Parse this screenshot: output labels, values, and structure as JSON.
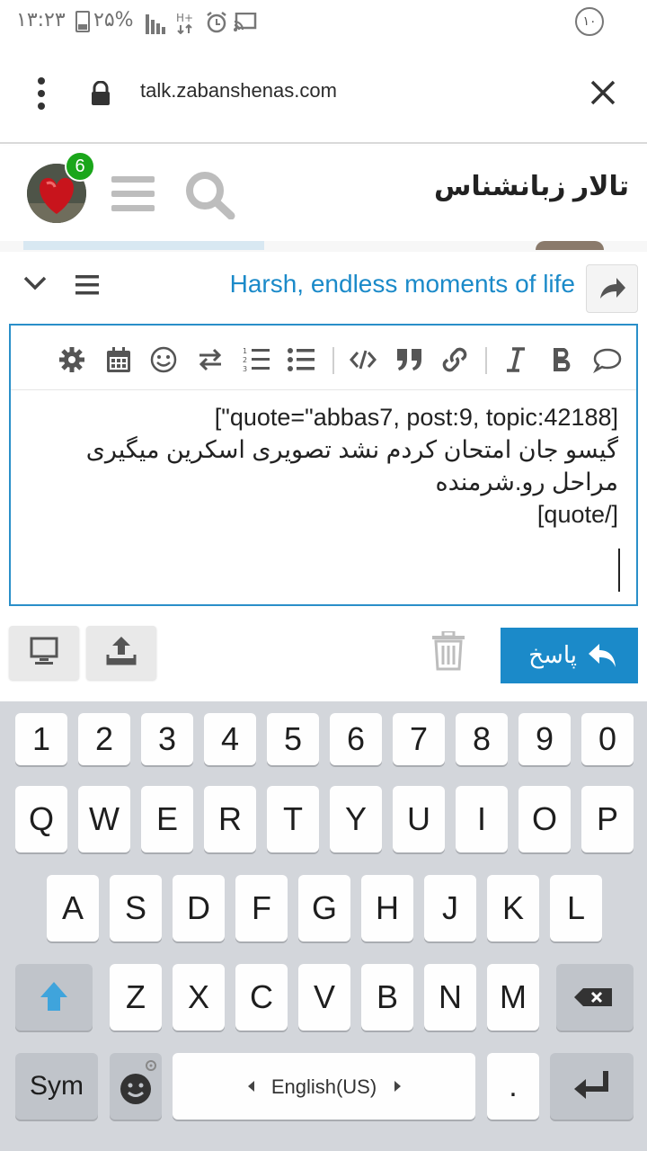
{
  "status_bar": {
    "time": "۱۳:۲۳",
    "battery": "۲۵%",
    "notification_count": "۱۰"
  },
  "browser": {
    "url": "talk.zabanshenas.com"
  },
  "site": {
    "title": "تالار زبانشناس",
    "notification_badge": "6"
  },
  "topic": {
    "title": "Harsh, endless moments of life"
  },
  "editor": {
    "lines": [
      "[\"quote=\"abbas7, post:9, topic:42188]",
      "گیسو جان امتحان کردم نشد تصویری اسکرین میگیری",
      "مراحل رو.شرمنده",
      "[quote/]"
    ]
  },
  "actions": {
    "reply_label": "پاسخ"
  },
  "keyboard": {
    "number_row": [
      "1",
      "2",
      "3",
      "4",
      "5",
      "6",
      "7",
      "8",
      "9",
      "0"
    ],
    "row1": [
      "Q",
      "W",
      "E",
      "R",
      "T",
      "Y",
      "U",
      "I",
      "O",
      "P"
    ],
    "row2": [
      "A",
      "S",
      "D",
      "F",
      "G",
      "H",
      "J",
      "K",
      "L"
    ],
    "row3": [
      "Z",
      "X",
      "C",
      "V",
      "B",
      "N",
      "M"
    ],
    "sym_label": "Sym",
    "space_label": "English(US)",
    "period_label": "."
  },
  "colors": {
    "accent": "#1b8ac9",
    "badge": "#1aa61a",
    "keyboard_bg": "#d3d6db"
  }
}
